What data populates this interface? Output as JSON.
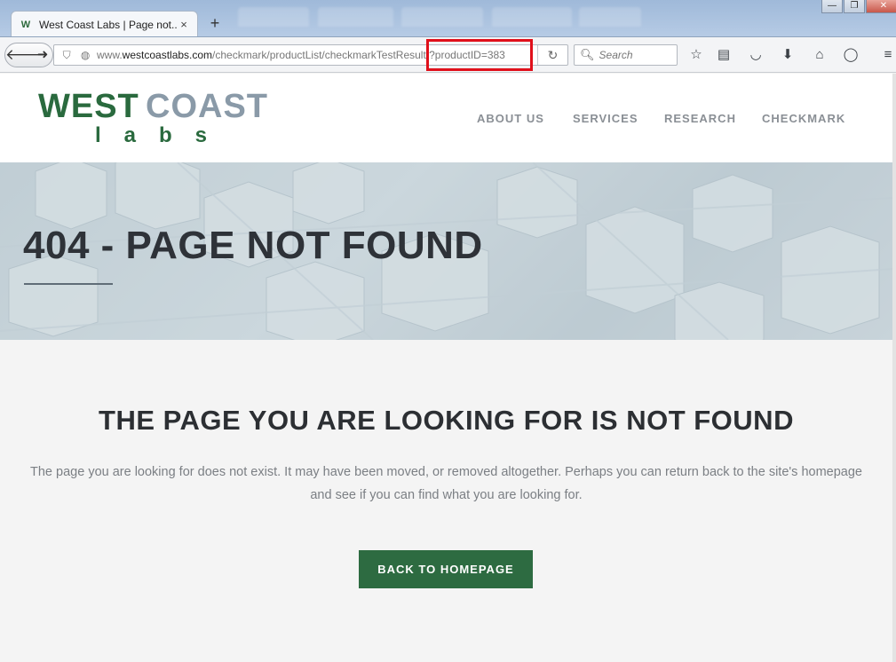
{
  "browser": {
    "tab": {
      "title": "West Coast Labs | Page not...",
      "close_glyph": "×",
      "favicon": "W"
    },
    "new_tab_glyph": "+",
    "url": {
      "prefix": "www.",
      "host": "westcoastlabs.com",
      "path": "/checkmark/productList/checkmarkTestResult/?productID=383"
    },
    "search_placeholder": "Search",
    "window_controls": {
      "minimize": "—",
      "maximize": "❐",
      "close": "✕"
    },
    "toolbar_icons": [
      "star-icon",
      "reading-list-icon",
      "pocket-icon",
      "download-icon",
      "home-icon",
      "chat-icon",
      "menu-icon"
    ],
    "highlight_color": "#e0101b"
  },
  "site": {
    "logo": {
      "west": "WEST",
      "coast": "COAST",
      "labs": "labs"
    },
    "nav": [
      {
        "label": "ABOUT US"
      },
      {
        "label": "SERVICES"
      },
      {
        "label": "RESEARCH"
      },
      {
        "label": "CHECKMARK"
      }
    ],
    "hero_title": "404 - PAGE NOT FOUND",
    "content": {
      "heading": "THE PAGE YOU ARE LOOKING FOR IS NOT FOUND",
      "text": "The page you are looking for does not exist. It may have been moved, or removed altogether. Perhaps you can return back to the site's homepage and see if you can find what you are looking for.",
      "button": "BACK TO HOMEPAGE"
    },
    "colors": {
      "brand_green": "#2a6a3e",
      "brand_grey": "#8a9aa8",
      "button": "#2d6b41"
    }
  }
}
